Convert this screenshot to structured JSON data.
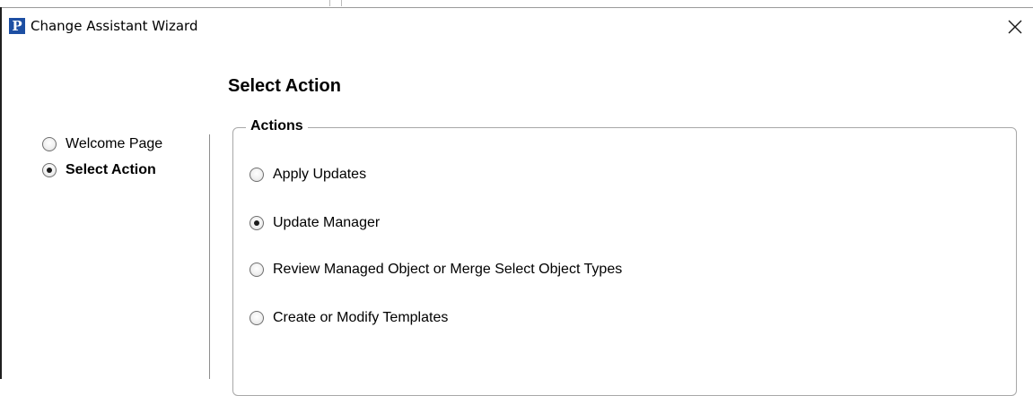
{
  "window": {
    "title": "Change Assistant Wizard",
    "app_icon_letter": "P",
    "icon": "close-icon"
  },
  "page": {
    "title": "Select Action"
  },
  "nav": {
    "items": [
      {
        "label": "Welcome Page",
        "selected": false
      },
      {
        "label": "Select Action",
        "selected": true
      }
    ]
  },
  "actions": {
    "legend": "Actions",
    "options": [
      {
        "label": "Apply Updates",
        "selected": false
      },
      {
        "label": "Update Manager",
        "selected": true
      },
      {
        "label": "Review Managed Object or Merge Select Object Types",
        "selected": false
      },
      {
        "label": "Create or Modify Templates",
        "selected": false
      }
    ]
  },
  "colors": {
    "app_icon_bg": "#1d4fa3",
    "frame": "#1f1f1f",
    "group_border": "#a8a8a8"
  }
}
